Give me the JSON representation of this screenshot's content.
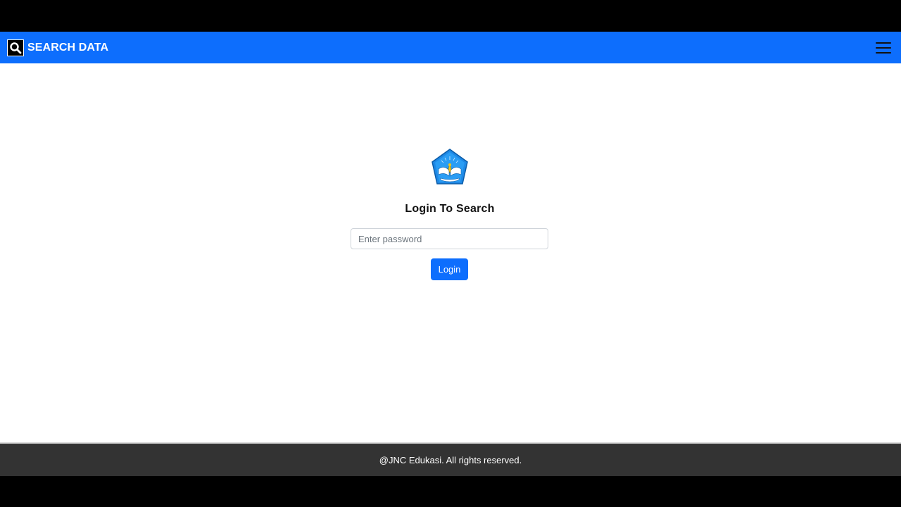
{
  "colors": {
    "brand_primary": "#0d6efd",
    "footer_bg": "#333333",
    "page_bg": "#ffffff",
    "letterbox": "#000000"
  },
  "navbar": {
    "title": "SEARCH DATA",
    "brand_icon": "search-icon",
    "menu_icon": "hamburger-menu-icon"
  },
  "login": {
    "logo": "tut-wuri-handayani-logo",
    "heading": "Login To Search",
    "password_placeholder": "Enter password",
    "password_value": "",
    "button_label": "Login"
  },
  "footer": {
    "text": "@JNC Edukasi. All rights reserved."
  }
}
